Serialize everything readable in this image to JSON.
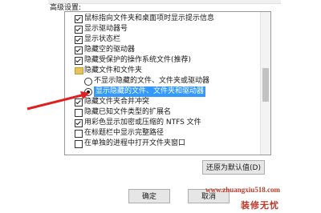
{
  "group_title": "高级设置:",
  "items": [
    {
      "label": "鼠标指向文件夹和桌面项时显示提示信息",
      "checked": true
    },
    {
      "label": "显示驱动器号",
      "checked": true
    },
    {
      "label": "显示状态栏",
      "checked": true
    },
    {
      "label": "隐藏空的驱动器",
      "checked": true
    },
    {
      "label": "隐藏受保护的操作系统文件(推荐)",
      "checked": true
    },
    {
      "label": "隐藏文件和文件夹"
    },
    {
      "label": "不显示隐藏的文件、文件夹或驱动器",
      "selected": false
    },
    {
      "label": "显示隐藏的文件、文件夹和驱动器",
      "selected": true
    },
    {
      "label": "隐藏文件夹合并冲突",
      "checked": true
    },
    {
      "label": "隐藏已知文件类型的扩展名",
      "checked": false
    },
    {
      "label": "用彩色显示加密或压缩的 NTFS 文件",
      "checked": true
    },
    {
      "label": "在标题栏中显示完整路径",
      "checked": false
    },
    {
      "label": "在单独的进程中打开文件夹窗口",
      "checked": false
    }
  ],
  "buttons": {
    "restore_defaults": "还原为默认值(D)",
    "ok": "确定",
    "cancel": "取消"
  },
  "watermark": {
    "url": "www.zhuangxiu518.com",
    "name": "装修无忧"
  },
  "colors": {
    "selection": "#3399ff",
    "annotation": "#e02020",
    "watermark": "#c0392b"
  }
}
